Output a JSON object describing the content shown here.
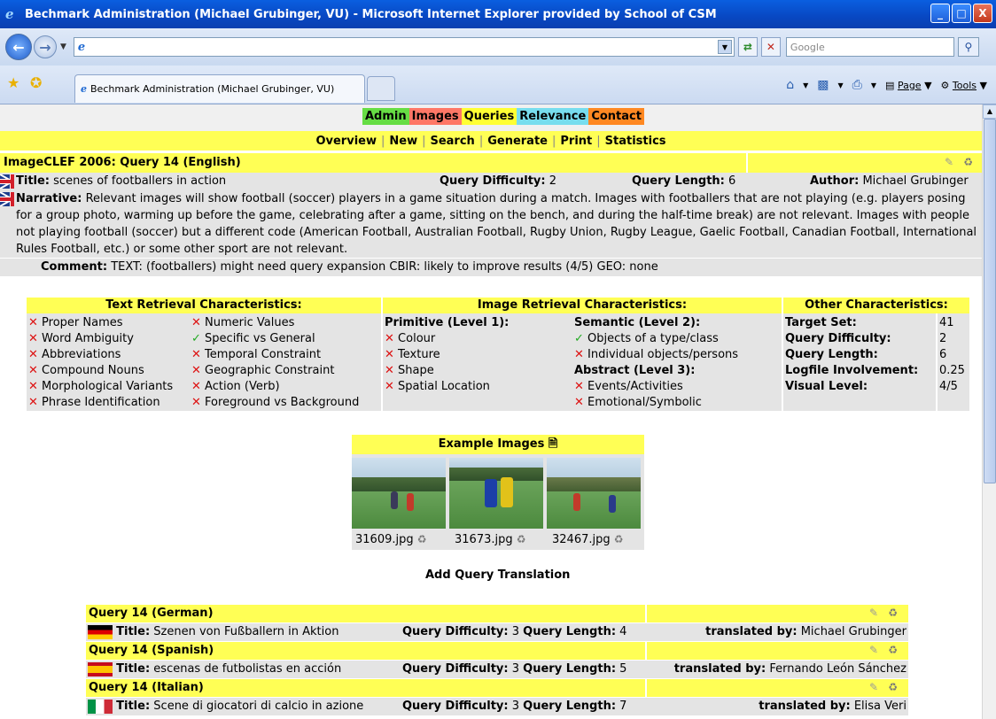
{
  "window": {
    "title": "Bechmark Administration (Michael Grubinger, VU) - Microsoft Internet Explorer provided by School of CSM",
    "buttons": [
      "_",
      "□",
      "X"
    ]
  },
  "browser": {
    "address_value": "",
    "search_placeholder": "Google",
    "tab_title": "Bechmark Administration (Michael Grubinger, VU)",
    "toolbar": {
      "page_label": "Page",
      "tools_label": "Tools"
    }
  },
  "menu": {
    "main": [
      "Admin",
      "Images",
      "Queries",
      "Relevance",
      "Contact"
    ],
    "sub": [
      "Overview",
      "New",
      "Search",
      "Generate",
      "Print",
      "Statistics"
    ]
  },
  "query": {
    "heading": "ImageCLEF 2006: Query 14 (English)",
    "title_label": "Title:",
    "title_value": "scenes of footballers in action",
    "difficulty_label": "Query Difficulty:",
    "difficulty_value": "2",
    "length_label": "Query Length:",
    "length_value": "6",
    "author_label": "Author:",
    "author_value": "Michael Grubinger",
    "narrative_label": "Narrative:",
    "narrative_value": "Relevant images will show football (soccer) players in a game situation during a match. Images with footballers that are not playing (e.g. players posing for a group photo, warming up before the game, celebrating after a game, sitting on the bench, and during the half-time break) are not relevant. Images with people not playing football (soccer) but a different code (American Football, Australian Football, Rugby Union, Rugby League, Gaelic Football, Canadian Football, International Rules Football, etc.) or some other sport are not relevant.",
    "comment_label": "Comment:",
    "comment_value": "TEXT: (footballers) might need query expansion CBIR: likely to improve results (4/5) GEO: none"
  },
  "characteristics": {
    "text_heading": "Text Retrieval Characteristics:",
    "text_col1": [
      "Proper Names",
      "Word Ambiguity",
      "Abbreviations",
      "Compound Nouns",
      "Morphological Variants",
      "Phrase Identification"
    ],
    "text_col2": [
      "Numeric Values",
      "Specific vs General",
      "Temporal Constraint",
      "Geographic Constraint",
      "Action (Verb)",
      "Foreground vs Background"
    ],
    "text_col2_marks": [
      "x",
      "check",
      "x",
      "x",
      "x",
      "x"
    ],
    "image_heading": "Image Retrieval Characteristics:",
    "primitive_label": "Primitive (Level 1):",
    "primitive_items": [
      "Colour",
      "Texture",
      "Shape",
      "Spatial Location"
    ],
    "semantic_label": "Semantic (Level 2):",
    "semantic_items": [
      "Objects of a type/class",
      "Individual objects/persons"
    ],
    "semantic_marks": [
      "check",
      "x"
    ],
    "abstract_label": "Abstract (Level 3):",
    "abstract_items": [
      "Events/Activities",
      "Emotional/Symbolic"
    ],
    "other_heading": "Other Characteristics:",
    "other_labels": [
      "Target Set:",
      "Query Difficulty:",
      "Query Length:",
      "Logfile Involvement:",
      "Visual Level:"
    ],
    "other_values": [
      "41",
      "2",
      "6",
      "0.25",
      "4/5"
    ]
  },
  "examples": {
    "heading": "Example Images",
    "files": [
      "31609.jpg",
      "31673.jpg",
      "32467.jpg"
    ]
  },
  "add_translation": "Add Query Translation",
  "translations": [
    {
      "heading": "Query 14 (German)",
      "title": "Szenen von Fußballern in Aktion",
      "difficulty": "3",
      "length": "4",
      "by_label": "translated by:",
      "by": "Michael Grubinger"
    },
    {
      "heading": "Query 14 (Spanish)",
      "title": "escenas de futbolistas en acción",
      "difficulty": "3",
      "length": "5",
      "by_label": "translated by:",
      "by": "Fernando León Sánchez"
    },
    {
      "heading": "Query 14 (Italian)",
      "title": "Scene di giocatori di calcio in azione",
      "difficulty": "3",
      "length": "7",
      "by_label": "translated by:",
      "by": "Elisa Veri"
    }
  ],
  "labels": {
    "title": "Title:",
    "difficulty": "Query Difficulty:",
    "length": "Query Length:"
  }
}
